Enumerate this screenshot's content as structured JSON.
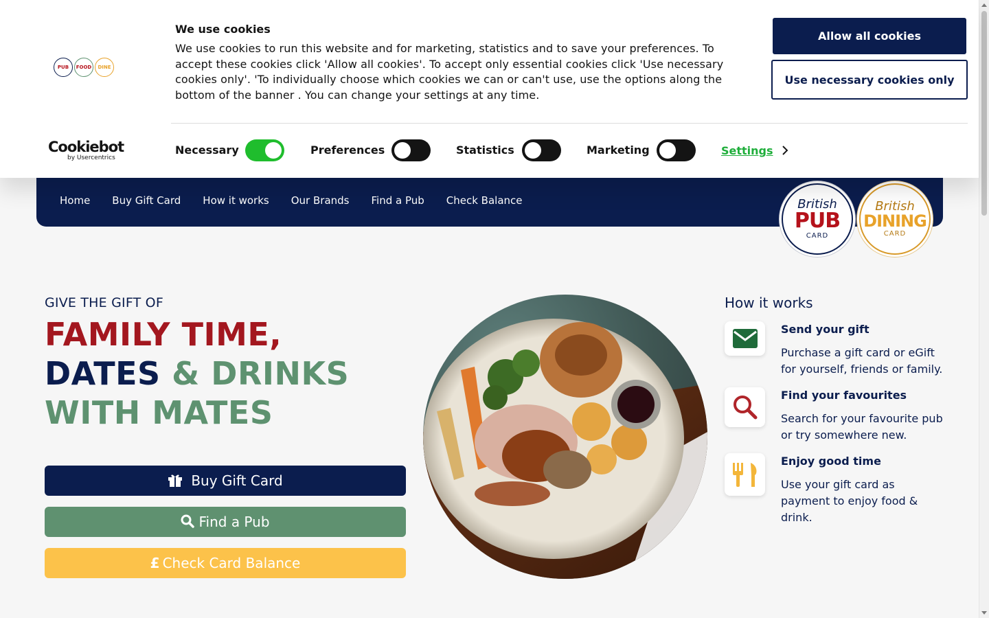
{
  "cookie_banner": {
    "title": "We use cookies",
    "body": "We use cookies to run this website and for marketing, statistics and to save your preferences. To accept these cookies click 'Allow all cookies'. To accept only essential cookies click 'Use necessary cookies only'. 'To individually choose which cookies we can or can't use, use the options along the bottom of the banner . You can change your settings at any time.",
    "allow_all_label": "Allow all cookies",
    "necessary_only_label": "Use necessary cookies only",
    "brand_main": "Cookiebot",
    "brand_sub": "by Usercentrics",
    "toggles": [
      {
        "label": "Necessary",
        "on": true
      },
      {
        "label": "Preferences",
        "on": false
      },
      {
        "label": "Statistics",
        "on": false
      },
      {
        "label": "Marketing",
        "on": false
      }
    ],
    "settings_label": "Settings",
    "colors": {
      "accent": "#0b1d4e",
      "toggle_on": "#1fbd2d",
      "link": "#1fae3b"
    }
  },
  "nav": {
    "items": [
      "Home",
      "Buy Gift Card",
      "How it works",
      "Our Brands",
      "Find a Pub",
      "Check Balance"
    ]
  },
  "badges": {
    "pub": {
      "small": "British",
      "big": "PUB",
      "card": "CARD"
    },
    "dining": {
      "small": "British",
      "big": "DINING",
      "card": "CARD"
    }
  },
  "hero": {
    "eyebrow": "GIVE THE GIFT OF",
    "line1": "FAMILY TIME,",
    "line2_a": "DATES",
    "line2_b": "& DRINKS",
    "line3": "WITH MATES"
  },
  "cta": {
    "buy": "Buy Gift Card",
    "find": "Find a Pub",
    "balance": "Check Card Balance"
  },
  "how_it_works": {
    "title": "How it works",
    "items": [
      {
        "icon": "envelope-icon",
        "heading": "Send your gift",
        "text": "Purchase a gift card or eGift for yourself, friends or family."
      },
      {
        "icon": "search-icon",
        "heading": "Find your favourites",
        "text": "Search for your favourite pub or try somewhere new."
      },
      {
        "icon": "cutlery-icon",
        "heading": "Enjoy good time",
        "text": "Use your gift card as payment to enjoy food & drink."
      }
    ]
  },
  "colors": {
    "navy": "#0b1d4e",
    "red": "#a3171f",
    "green": "#5e9270",
    "yellow": "#fcc24a"
  }
}
